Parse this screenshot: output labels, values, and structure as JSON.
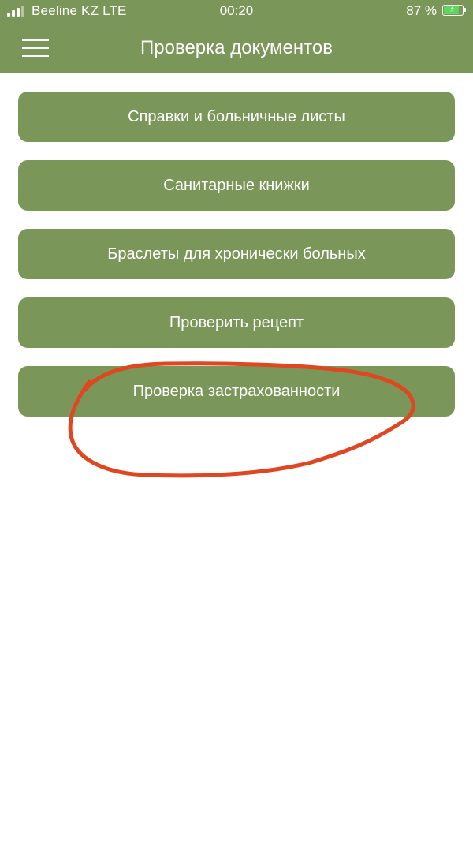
{
  "status_bar": {
    "carrier": "Beeline KZ  LTE",
    "time": "00:20",
    "battery": "87 %",
    "battery_level": 0.87
  },
  "header": {
    "title": "Проверка документов",
    "menu_icon": "hamburger-menu-icon"
  },
  "menu": {
    "items": [
      {
        "label": "Справки и больничные листы"
      },
      {
        "label": "Санитарные книжки"
      },
      {
        "label": "Браслеты для хронически больных"
      },
      {
        "label": "Проверить рецепт"
      },
      {
        "label": "Проверка застрахованности"
      }
    ]
  },
  "colors": {
    "accent": "#7a9658",
    "annotation": "#e0461f",
    "battery_charge": "#5bd85c"
  }
}
